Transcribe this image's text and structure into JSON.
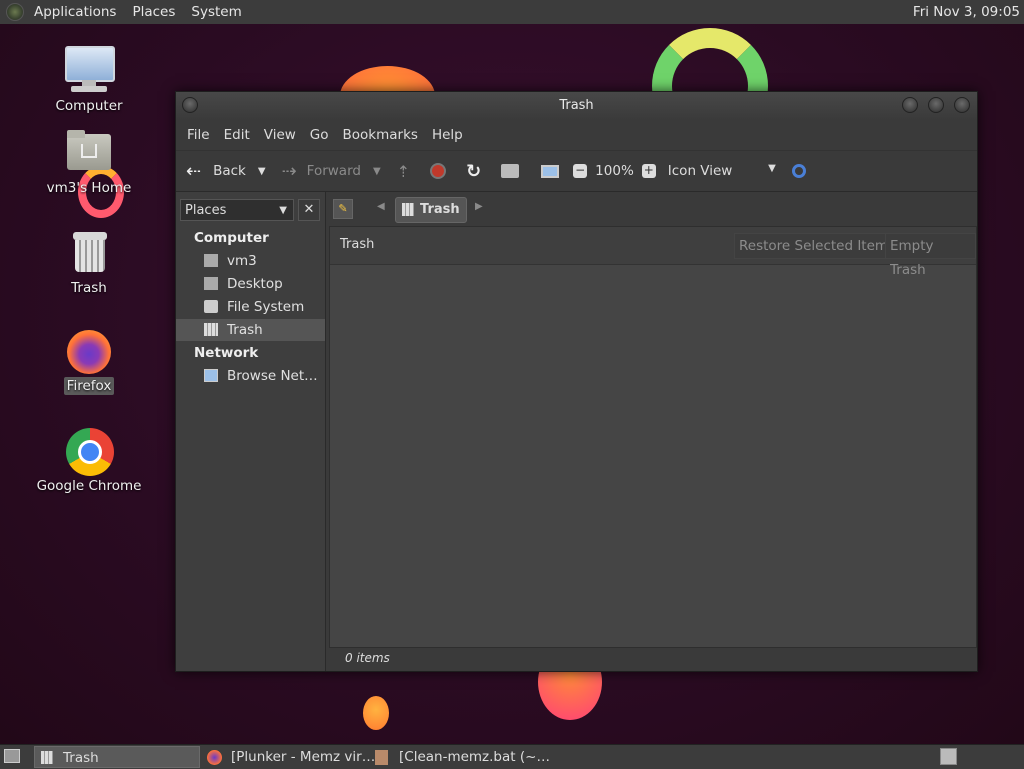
{
  "top_panel": {
    "menus": [
      "Applications",
      "Places",
      "System"
    ],
    "clock": "Fri Nov 3, 09:05"
  },
  "desktop_icons": [
    {
      "label": "Computer",
      "icon": "computer-icon"
    },
    {
      "label": "vm3's Home",
      "icon": "home-folder-icon"
    },
    {
      "label": "Trash",
      "icon": "trash-icon"
    },
    {
      "label": "Firefox",
      "icon": "firefox-icon",
      "selected": true
    },
    {
      "label": "Google Chrome",
      "icon": "chrome-icon"
    }
  ],
  "window": {
    "title": "Trash",
    "menubar": [
      "File",
      "Edit",
      "View",
      "Go",
      "Bookmarks",
      "Help"
    ],
    "toolbar": {
      "back": "Back",
      "forward": "Forward",
      "zoom": "100%",
      "view_mode": "Icon View"
    },
    "sidepane": {
      "combo": "Places",
      "computer_header": "Computer",
      "computer_items": [
        "vm3",
        "Desktop",
        "File System",
        "Trash"
      ],
      "network_header": "Network",
      "network_items": [
        "Browse Net…"
      ]
    },
    "pathbar": {
      "current": "Trash"
    },
    "infobar": {
      "label": "Trash",
      "restore_button": "Restore Selected Items",
      "empty_button": "Empty Trash"
    },
    "status": "0 items"
  },
  "taskbar": {
    "tasks": [
      "Trash",
      "[Plunker - Memz vir…",
      "[Clean-memz.bat (~…"
    ]
  },
  "colors": {
    "panel": "#3c3c3c",
    "window_bg": "#3a3a3a",
    "content_bg": "#454545",
    "desktop_bg": "#2b0d24"
  }
}
